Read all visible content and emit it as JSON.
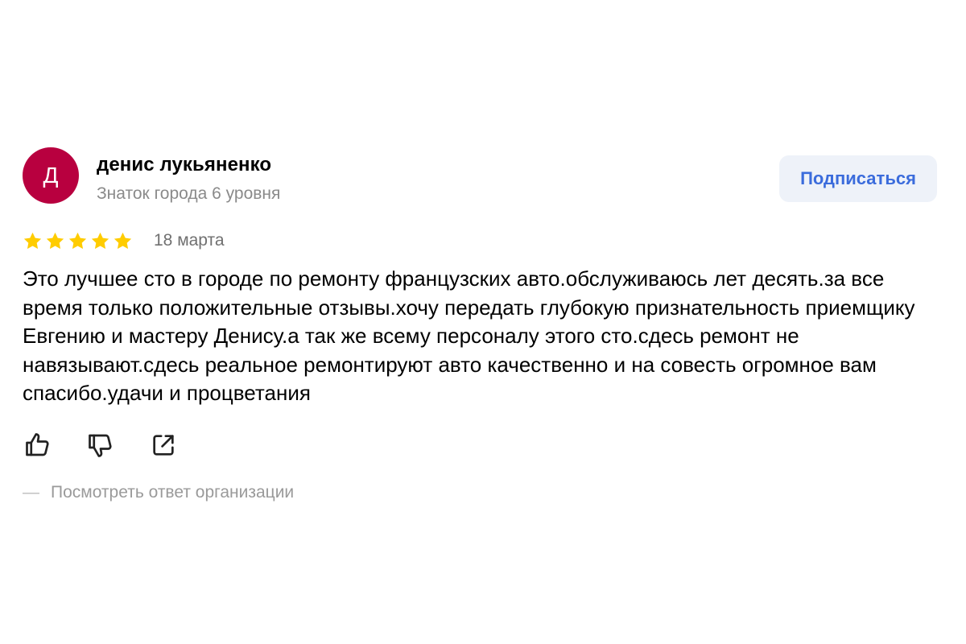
{
  "author": {
    "initial": "Д",
    "name": "денис лукьяненко",
    "level": "Знаток города 6 уровня",
    "avatar_color": "#b8003f"
  },
  "subscribe_label": "Подписаться",
  "rating": {
    "value": 5,
    "max": 5,
    "star_color": "#ffcc00"
  },
  "date": "18 марта",
  "text": "Это лучшее сто в городе по ремонту французских авто.обслуживаюсь лет десять.за все время только положительные отзывы.хочу передать глубокую признательность приемщику Евгению и мастеру Денису.а так же всему персоналу этого сто.сдесь ремонт не навязывают.сдесь реальное ремонтируют авто качественно и на совесть огромное вам спасибо.удачи и процветания",
  "actions": {
    "like_icon": "thumbs-up-icon",
    "dislike_icon": "thumbs-down-icon",
    "share_icon": "share-icon"
  },
  "org_reply": {
    "dash": "—",
    "label": "Посмотреть ответ организации"
  }
}
